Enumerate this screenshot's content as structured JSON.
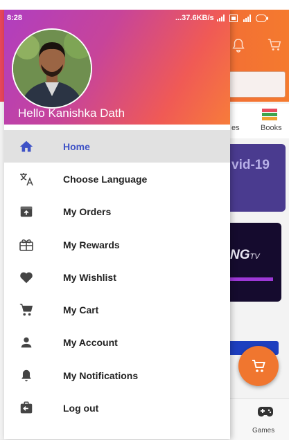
{
  "status_bar": {
    "time": "8:28",
    "network_speed": "...37.6KB/s"
  },
  "drawer": {
    "greeting": "Hello Kanishka Dath",
    "items": [
      {
        "label": "Home",
        "icon": "home-icon",
        "active": true
      },
      {
        "label": "Choose Language",
        "icon": "translate-icon",
        "active": false
      },
      {
        "label": "My Orders",
        "icon": "orders-icon",
        "active": false
      },
      {
        "label": "My Rewards",
        "icon": "rewards-icon",
        "active": false
      },
      {
        "label": "My Wishlist",
        "icon": "heart-icon",
        "active": false
      },
      {
        "label": "My Cart",
        "icon": "cart-icon",
        "active": false
      },
      {
        "label": "My Account",
        "icon": "account-icon",
        "active": false
      },
      {
        "label": "My Notifications",
        "icon": "bell-icon",
        "active": false
      },
      {
        "label": "Log out",
        "icon": "logout-icon",
        "active": false
      }
    ]
  },
  "background": {
    "categories": [
      "es",
      "Books"
    ],
    "banner_text": "vid-19",
    "tv_text": "NG",
    "tv_suffix": "TV",
    "bottom_nav_label": "Games"
  },
  "colors": {
    "accent": "#3e52c6",
    "header_start": "#b03ec0",
    "header_end": "#f77c3a",
    "active_bg": "#e1e1e1",
    "fab": "#f0762f"
  }
}
